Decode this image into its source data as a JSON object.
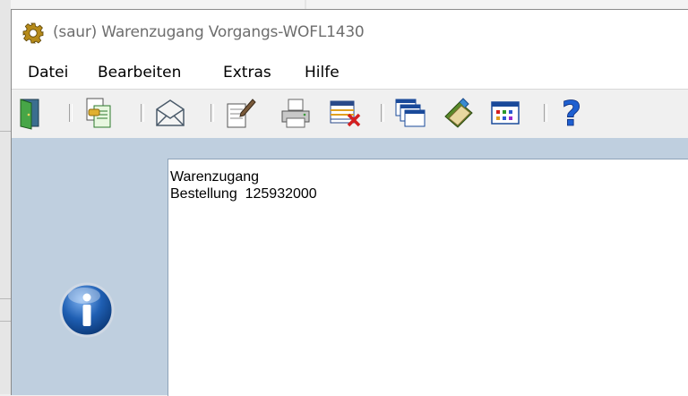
{
  "window": {
    "title": "(saur) Warenzugang Vorgangs-WOFL1430",
    "title_icon": "gear-icon"
  },
  "menu": [
    "Datei",
    "Bearbeiten",
    "Extras",
    "Hilfe"
  ],
  "toolbar": {
    "buttons": [
      "exit-door-icon",
      "copy-document-icon",
      "email-envelope-icon",
      "edit-document-icon",
      "print-icon",
      "delete-table-icon",
      "windows-cascade-icon",
      "book-icon",
      "table-grid-icon",
      "help-icon"
    ]
  },
  "message": {
    "icon": "info-icon",
    "lines": [
      "Warenzugang",
      "Bestellung  125932000"
    ]
  },
  "colors": {
    "content_bg": "#bfcfdf",
    "info_blue": "#1f5fb3"
  }
}
